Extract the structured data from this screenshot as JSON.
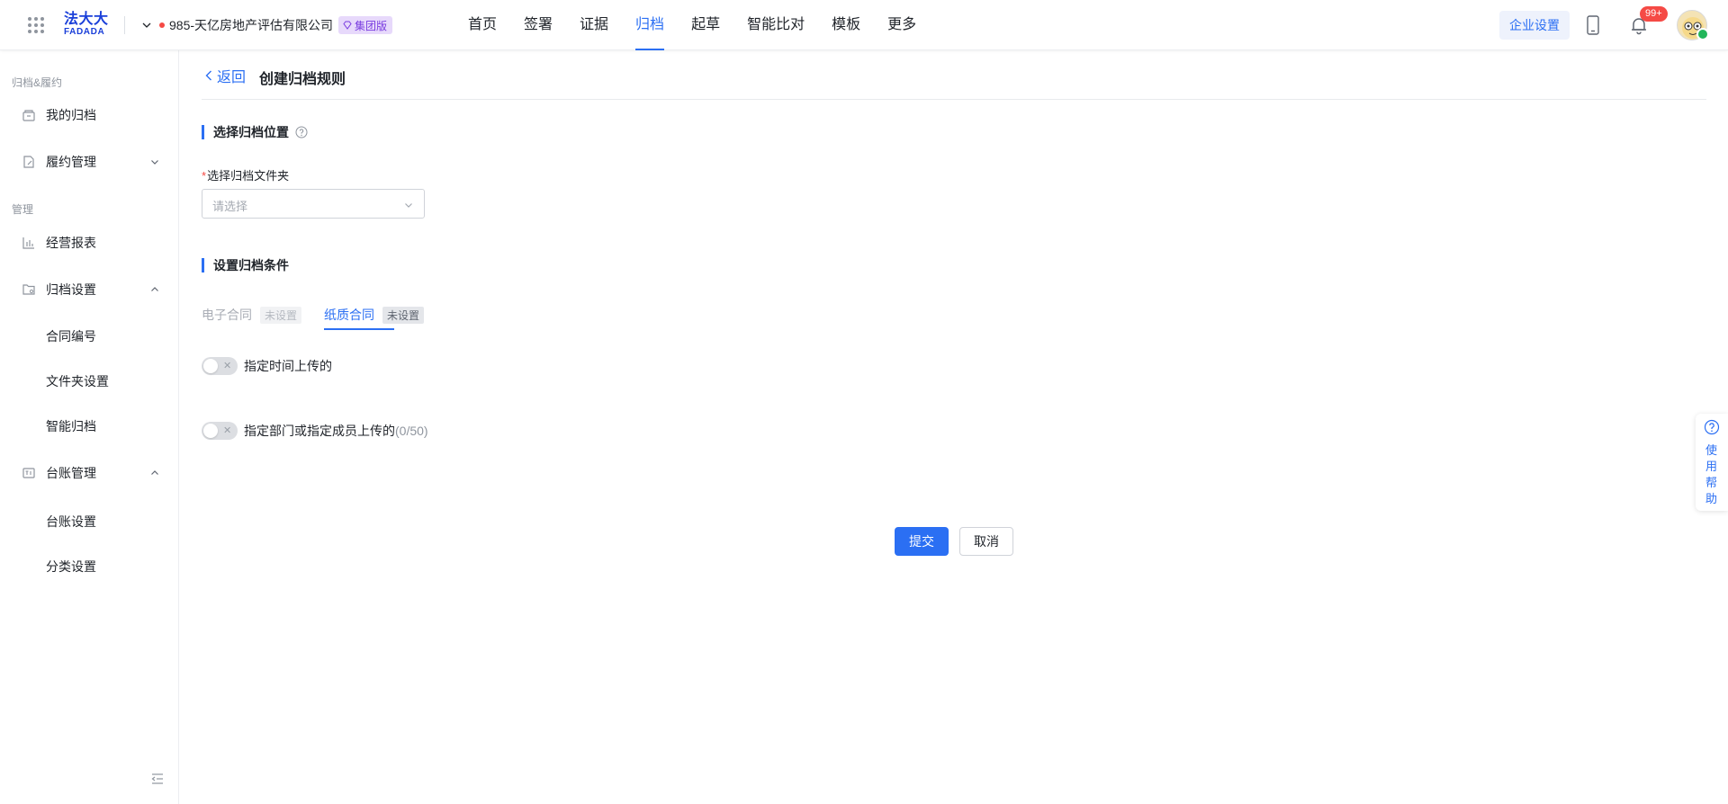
{
  "header": {
    "logo_cn": "法大大",
    "logo_en": "FADADA",
    "company_name": "985-天亿房地产评估有限公司",
    "company_badge": "集团版",
    "nav": [
      "首页",
      "签署",
      "证据",
      "归档",
      "起草",
      "智能比对",
      "模板",
      "更多"
    ],
    "active_nav": "归档",
    "enterprise_settings": "企业设置",
    "notification_count": "99+"
  },
  "sidebar": {
    "group1_title": "归档&履约",
    "my_archive": "我的归档",
    "performance": "履约管理",
    "group2_title": "管理",
    "business_report": "经营报表",
    "archive_settings": "归档设置",
    "contract_number": "合同编号",
    "folder_settings": "文件夹设置",
    "smart_archive": "智能归档",
    "ledger_mgmt": "台账管理",
    "ledger_settings": "台账设置",
    "category_settings": "分类设置"
  },
  "main": {
    "back_label": "返回",
    "page_title": "创建归档规则",
    "section1_title": "选择归档位置",
    "folder_label_req": "*",
    "folder_label": "选择归档文件夹",
    "folder_placeholder": "请选择",
    "section2_title": "设置归档条件",
    "tabs": [
      {
        "label": "电子合同",
        "tag": "未设置",
        "active": false
      },
      {
        "label": "纸质合同",
        "tag": "未设置",
        "active": true
      }
    ],
    "toggle1_label": "指定时间上传的",
    "toggle2_label": "指定部门或指定成员上传的",
    "toggle2_count": "(0/50)",
    "submit": "提交",
    "cancel": "取消"
  },
  "help_widget": {
    "label": "使用帮助"
  },
  "colors": {
    "accent": "#2b6ff3",
    "badge_purple": "#7a3ce0",
    "notification_red": "#f54a45"
  }
}
